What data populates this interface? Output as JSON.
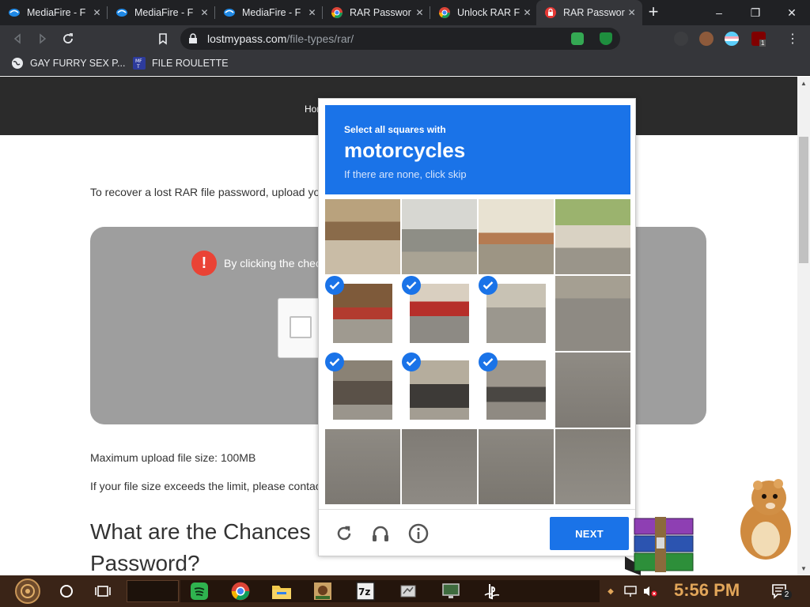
{
  "browser": {
    "tabs": [
      {
        "label": "MediaFire - F",
        "favicon": "mediafire-icon",
        "active": false
      },
      {
        "label": "MediaFire - F",
        "favicon": "mediafire-icon",
        "active": false
      },
      {
        "label": "MediaFire - F",
        "favicon": "mediafire-icon",
        "active": false
      },
      {
        "label": "RAR Passwor",
        "favicon": "chrome-icon",
        "active": false
      },
      {
        "label": "Unlock RAR F",
        "favicon": "chrome-icon",
        "active": false
      },
      {
        "label": "RAR Passwor",
        "favicon": "lostmypass-icon",
        "active": true
      }
    ],
    "new_tab": "+",
    "window_controls": {
      "minimize": "–",
      "restore": "❐",
      "close": "✕"
    },
    "url_host": "lostmypass.com",
    "url_path": "/file-types/rar/",
    "bookmarks": [
      {
        "label": "GAY FURRY SEX P...",
        "icon": "globe-icon"
      },
      {
        "label": "FILE ROULETTE",
        "icon": "mediafire-bookmark-icon"
      }
    ],
    "extension_badge": "1",
    "colors": {
      "tab_bar": "#202124",
      "toolbar": "#35363a"
    }
  },
  "page": {
    "nav_fragment": "Hom",
    "intro": "To recover a lost RAR file password, upload you",
    "warning": "By clicking the chec",
    "max_size": "Maximum upload file size: 100MB",
    "exceeds": "If your file size exceeds the limit, please contac",
    "heading": "What are the Chances Password?"
  },
  "captcha": {
    "instruction": "Select all squares with",
    "target": "motorcycles",
    "hint": "If there are none, click skip",
    "next_label": "NEXT",
    "grid": {
      "rows": 4,
      "cols": 4,
      "selected": [
        false,
        false,
        false,
        false,
        true,
        true,
        true,
        false,
        true,
        true,
        true,
        false,
        false,
        false,
        false,
        false
      ]
    },
    "icons": [
      "reload-icon",
      "audio-icon",
      "info-icon"
    ],
    "colors": {
      "accent": "#1a73e8"
    }
  },
  "taskbar": {
    "time": "5:56 PM",
    "notification_count": "2",
    "apps": [
      "start-icon",
      "cortana-icon",
      "task-view-icon",
      "spotify-icon",
      "chrome-icon",
      "file-explorer-icon",
      "game-icon",
      "7zip-icon",
      "tool-icon",
      "monitor-icon",
      "playstation-icon"
    ]
  },
  "desktop": {
    "icons": [
      "hamster-icon",
      "winrar-icon"
    ]
  }
}
